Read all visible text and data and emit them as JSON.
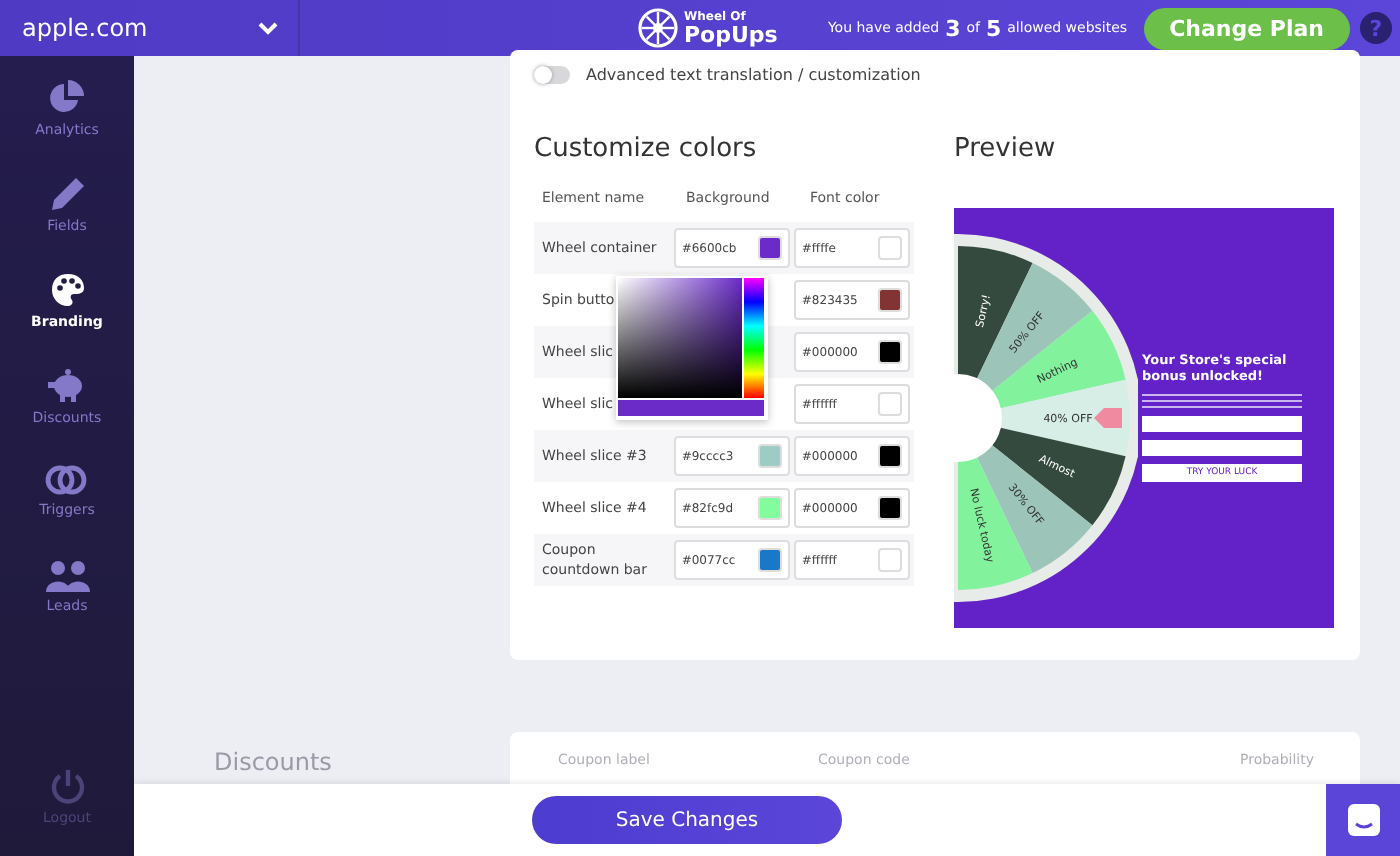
{
  "topbar": {
    "site": "apple.com",
    "logo_top": "Wheel Of",
    "logo_bottom": "PopUps",
    "added_prefix": "You have added",
    "added": "3",
    "of": "of",
    "allowed": "5",
    "suffix": "allowed websites",
    "plan_button": "Change Plan",
    "help": "?"
  },
  "sidebar": {
    "items": [
      {
        "label": "Analytics",
        "kind": "pie",
        "selected": false
      },
      {
        "label": "Fields",
        "kind": "pencil",
        "selected": false
      },
      {
        "label": "Branding",
        "kind": "palette",
        "selected": true
      },
      {
        "label": "Discounts",
        "kind": "piggy",
        "selected": false
      },
      {
        "label": "Triggers",
        "kind": "rings",
        "selected": false
      },
      {
        "label": "Leads",
        "kind": "people",
        "selected": false
      }
    ],
    "logout": "Logout"
  },
  "toggle": {
    "label": "Advanced text translation / customization",
    "on": false
  },
  "colors": {
    "title": "Customize colors",
    "headers": [
      "Element name",
      "Background",
      "Font color"
    ],
    "rows": [
      {
        "name": "Wheel container",
        "background": {
          "value": "#6600cb",
          "color": "#6a2bc9"
        },
        "font": {
          "value": "#ffffe",
          "color": "#ffffff"
        }
      },
      {
        "name": "Spin butto",
        "font": {
          "value": "#823435",
          "color": "#823435"
        }
      },
      {
        "name": "Wheel slic",
        "font": {
          "value": "#000000",
          "color": "#000000"
        }
      },
      {
        "name": "Wheel slic",
        "font": {
          "value": "#ffffff",
          "color": "#ffffff"
        }
      },
      {
        "name": "Wheel slice #3",
        "background": {
          "value": "#9cccc3",
          "color": "#9cccc3"
        },
        "font": {
          "value": "#000000",
          "color": "#000000"
        }
      },
      {
        "name": "Wheel slice #4",
        "background": {
          "value": "#82fc9d",
          "color": "#82fc9d"
        },
        "font": {
          "value": "#000000",
          "color": "#000000"
        }
      },
      {
        "name": "Coupon countdown bar",
        "background": {
          "value": "#0077cc",
          "color": "#1a78c8"
        },
        "font": {
          "value": "#ffffff",
          "color": "#ffffff"
        }
      }
    ],
    "picker": {
      "open": true,
      "color": "#6a2bc9"
    }
  },
  "preview": {
    "title": "Preview",
    "slices": [
      {
        "label": "Sorry!",
        "color": "#354a3f"
      },
      {
        "label": "50% OFF",
        "color": "#9cc4b8"
      },
      {
        "label": "Nothing",
        "color": "#82f29d"
      },
      {
        "label": "40% OFF",
        "color": "#d6eee6"
      },
      {
        "label": "Almost",
        "color": "#354a3f"
      },
      {
        "label": "30% OFF",
        "color": "#9cc4b8"
      },
      {
        "label": "No luck today",
        "color": "#82f29d"
      }
    ],
    "heading": "Your Store's special bonus unlocked!",
    "cta": "TRY YOUR LUCK"
  },
  "discounts": {
    "title": "Discounts",
    "columns": [
      "Coupon label",
      "Coupon code",
      "Probability"
    ]
  },
  "save_button": "Save Changes"
}
